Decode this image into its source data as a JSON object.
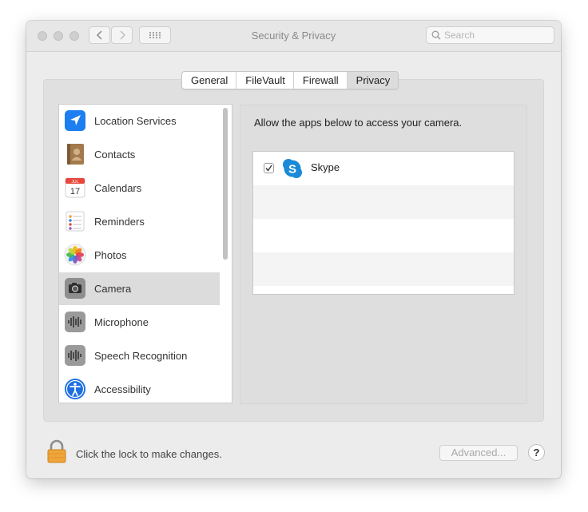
{
  "window": {
    "title": "Security & Privacy",
    "search_placeholder": "Search"
  },
  "tabs": [
    {
      "label": "General",
      "active": false
    },
    {
      "label": "FileVault",
      "active": false
    },
    {
      "label": "Firewall",
      "active": false
    },
    {
      "label": "Privacy",
      "active": true
    }
  ],
  "sidebar": {
    "items": [
      {
        "label": "Location Services",
        "icon": "location-arrow-icon"
      },
      {
        "label": "Contacts",
        "icon": "contacts-book-icon"
      },
      {
        "label": "Calendars",
        "icon": "calendar-icon",
        "icon_text_month": "JUL",
        "icon_text_day": "17"
      },
      {
        "label": "Reminders",
        "icon": "reminders-list-icon"
      },
      {
        "label": "Photos",
        "icon": "photos-flower-icon"
      },
      {
        "label": "Camera",
        "icon": "camera-icon",
        "selected": true
      },
      {
        "label": "Microphone",
        "icon": "microphone-waveform-icon"
      },
      {
        "label": "Speech Recognition",
        "icon": "speech-waveform-icon"
      },
      {
        "label": "Accessibility",
        "icon": "accessibility-person-icon"
      }
    ]
  },
  "content": {
    "instructions": "Allow the apps below to access your camera.",
    "apps": [
      {
        "name": "Skype",
        "checked": true,
        "icon": "skype-icon"
      }
    ]
  },
  "footer": {
    "lock_text": "Click the lock to make changes.",
    "advanced_label": "Advanced...",
    "help_label": "?"
  },
  "colors": {
    "window_bg": "#ececec",
    "selected_row": "#dcdcdc",
    "skype_blue": "#1b8ad8",
    "location_blue": "#1c7ef0",
    "lock_orange": "#f0a53a"
  }
}
